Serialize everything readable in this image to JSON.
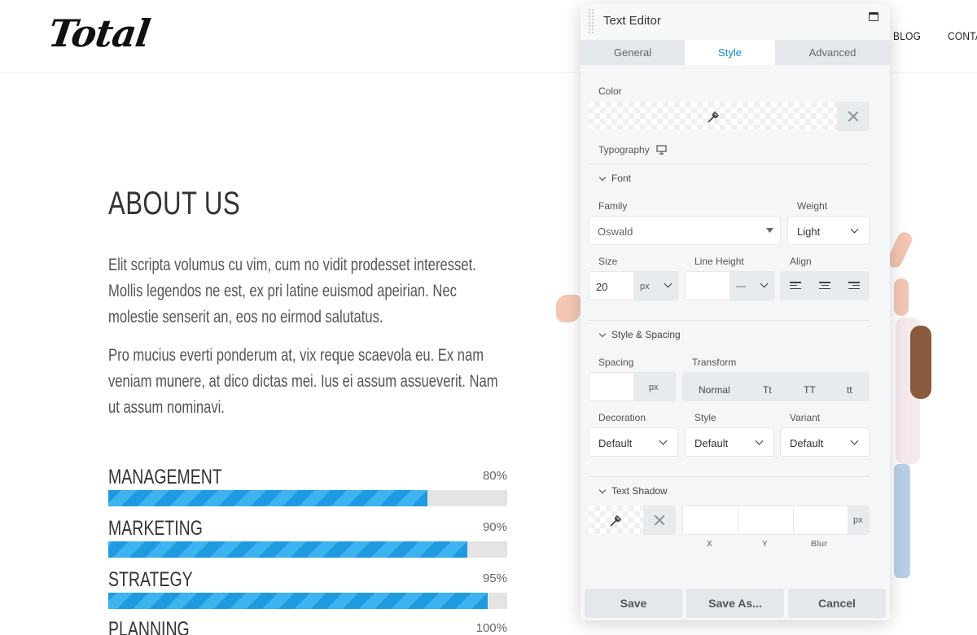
{
  "header": {
    "logo": "Total",
    "nav": [
      "BLOG",
      "CONTA"
    ]
  },
  "content": {
    "title": "ABOUT US",
    "paragraphs": [
      "Elit scripta volumus cu vim, cum no vidit prodesset interesset. Mollis legendos ne est, ex pri latine euismod apeirian. Nec molestie senserit an, eos no eirmod salutatus.",
      "Pro mucius everti ponderum at, vix reque scaevola eu. Ex nam veniam munere, at dico dictas mei. Ius ei assum assueverit. Nam ut assum nominavi."
    ],
    "skills": [
      {
        "label": "MANAGEMENT",
        "percent_label": "80%",
        "value": 80
      },
      {
        "label": "MARKETING",
        "percent_label": "90%",
        "value": 90
      },
      {
        "label": "STRATEGY",
        "percent_label": "95%",
        "value": 95
      },
      {
        "label": "PLANNING",
        "percent_label": "100%",
        "value": 100
      }
    ]
  },
  "editor": {
    "title": "Text Editor",
    "tabs": [
      "General",
      "Style",
      "Advanced"
    ],
    "active_tab": "Style",
    "color_label": "Color",
    "typography_label": "Typography",
    "font_section": "Font",
    "family_label": "Family",
    "family_value": "Oswald",
    "weight_label": "Weight",
    "weight_value": "Light",
    "size_label": "Size",
    "size_value": "20",
    "size_unit": "px",
    "line_height_label": "Line Height",
    "line_height_unit": "—",
    "align_label": "Align",
    "style_spacing_section": "Style & Spacing",
    "spacing_label": "Spacing",
    "spacing_unit": "px",
    "transform_label": "Transform",
    "transform_options": [
      "Normal",
      "Tt",
      "TT",
      "tt"
    ],
    "decoration_label": "Decoration",
    "decoration_value": "Default",
    "style_label": "Style",
    "style_value": "Default",
    "variant_label": "Variant",
    "variant_value": "Default",
    "text_shadow_section": "Text Shadow",
    "shadow_unit": "px",
    "shadow_fields": [
      "X",
      "Y",
      "Blur"
    ],
    "buttons": {
      "save": "Save",
      "save_as": "Save As...",
      "cancel": "Cancel"
    },
    "accent_color": "#0e8ad1"
  },
  "colors": {
    "bar_fill": "#1e9be0",
    "bar_track": "#e4e4e4"
  }
}
